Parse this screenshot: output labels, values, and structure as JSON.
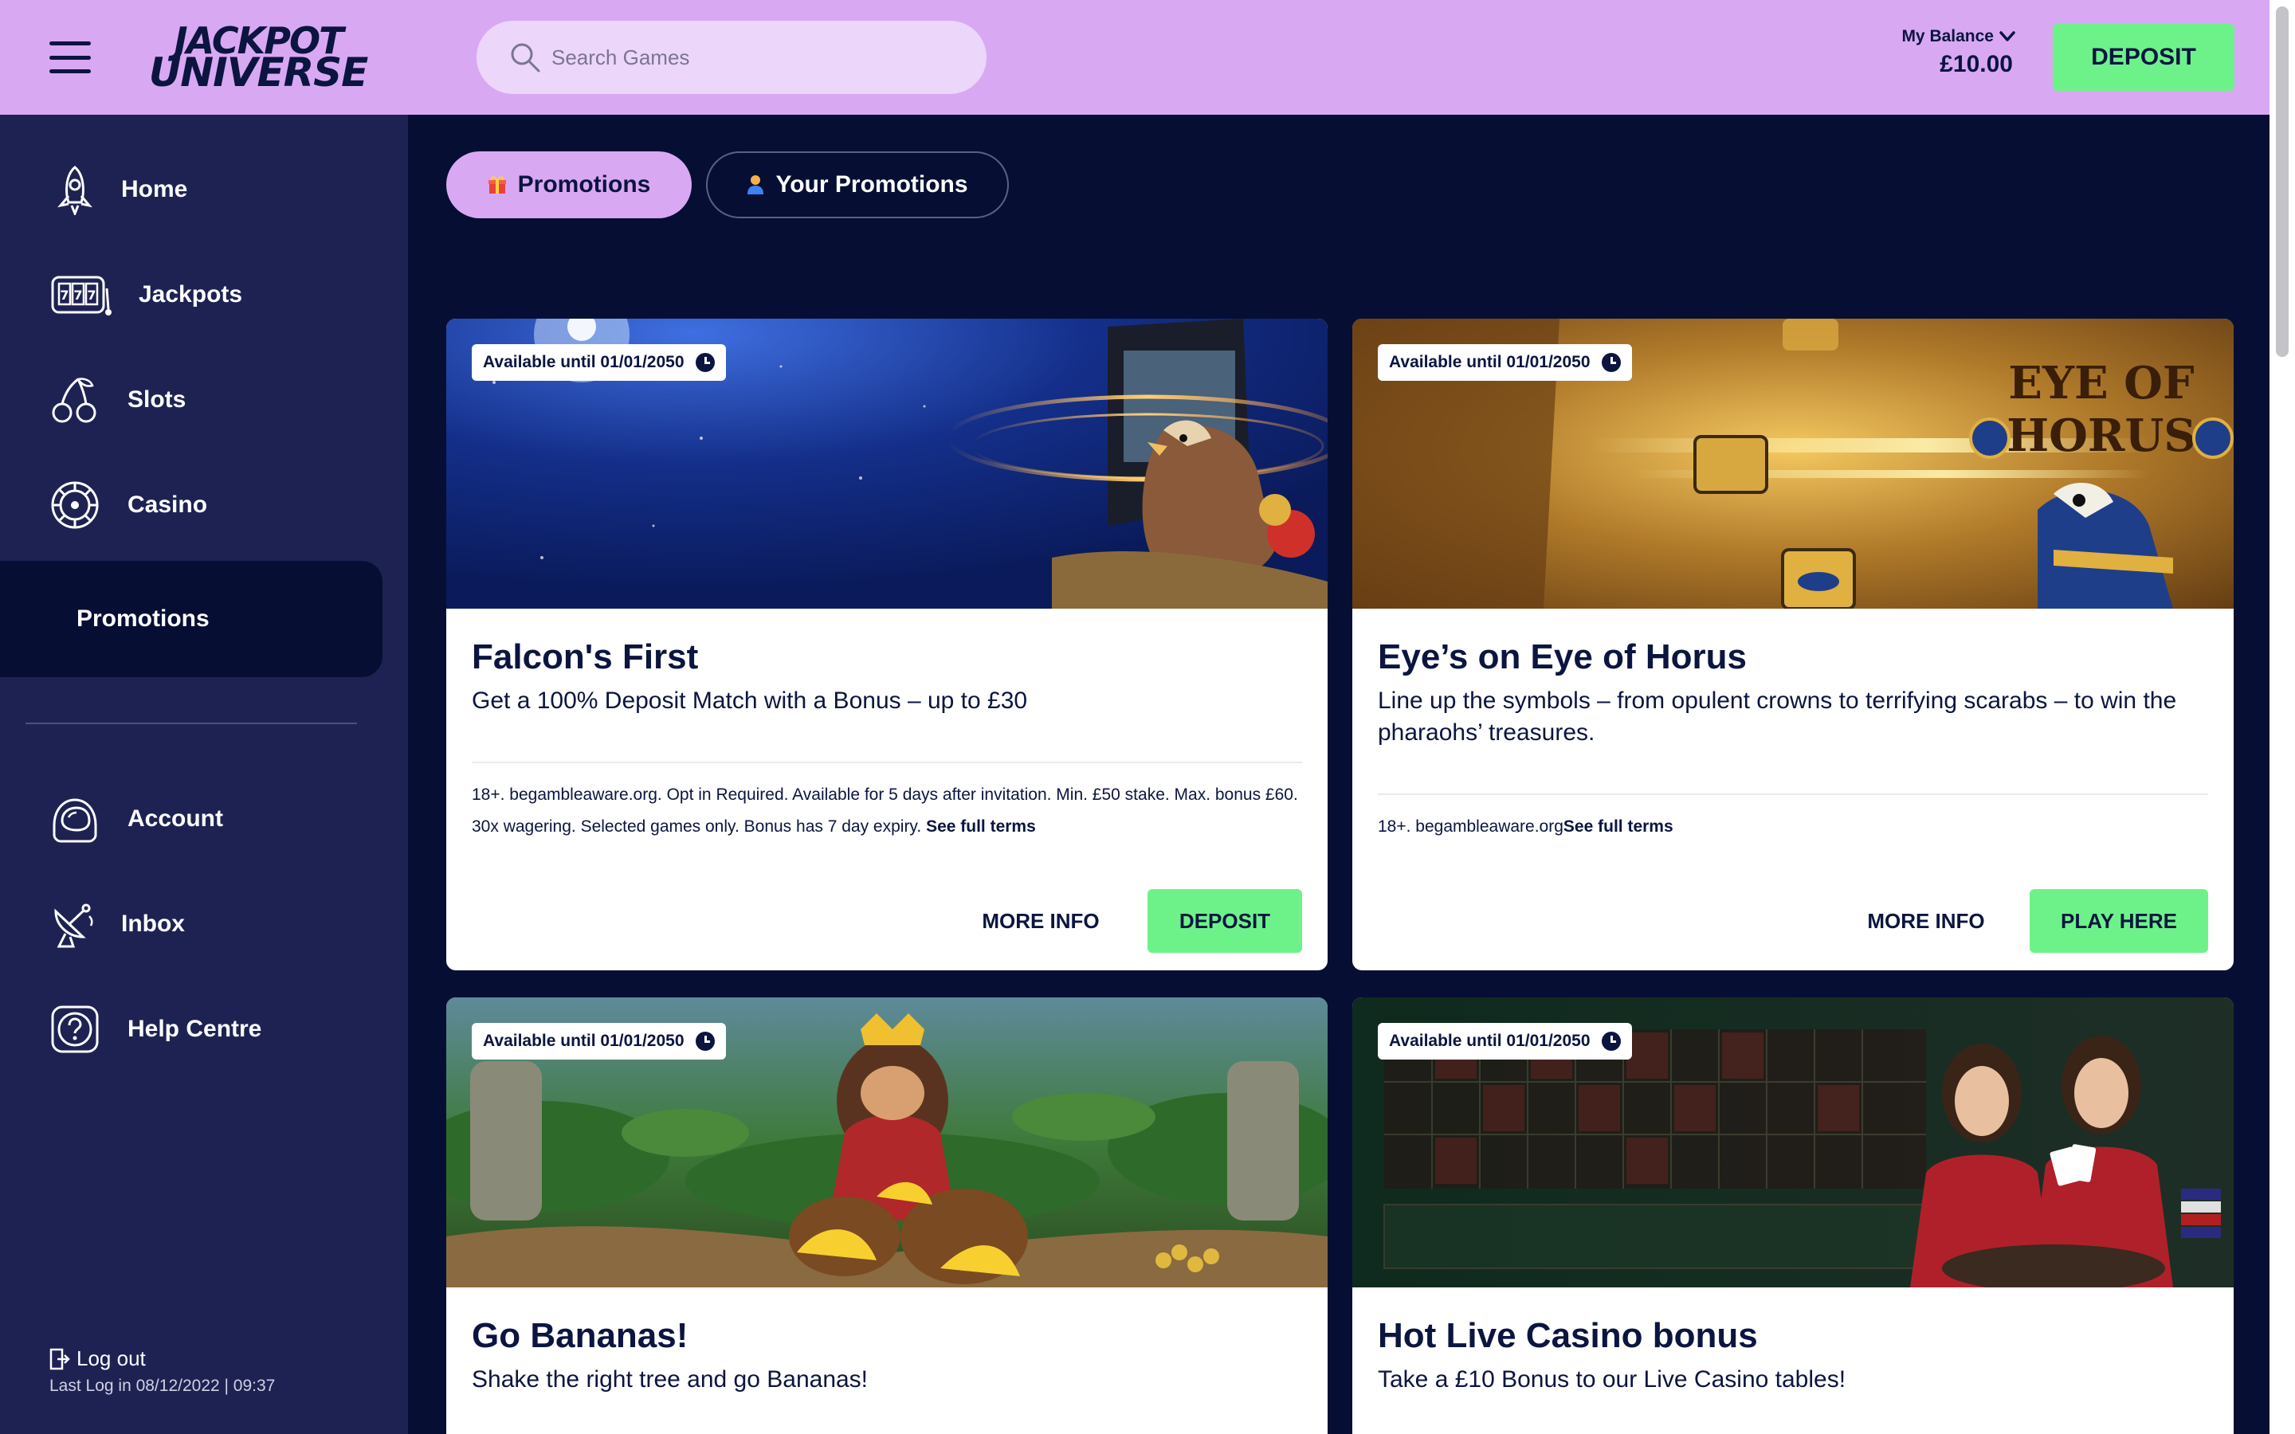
{
  "header": {
    "logo_line1": "JACKPOT",
    "logo_line2": "UNIVERSE",
    "search_placeholder": "Search Games",
    "balance_label": "My Balance",
    "balance_amount": "£10.00",
    "deposit_label": "DEPOSIT"
  },
  "sidebar": {
    "items": [
      {
        "label": "Home",
        "icon": "rocket-icon"
      },
      {
        "label": "Jackpots",
        "icon": "slot-machine-icon"
      },
      {
        "label": "Slots",
        "icon": "cherries-icon"
      },
      {
        "label": "Casino",
        "icon": "roulette-icon"
      },
      {
        "label": "Promotions",
        "icon": ""
      },
      {
        "label": "Account",
        "icon": "astronaut-helmet-icon"
      },
      {
        "label": "Inbox",
        "icon": "satellite-dish-icon"
      },
      {
        "label": "Help Centre",
        "icon": "question-icon"
      }
    ],
    "logout": "Log out",
    "last_log": "Last Log in 08/12/2022 | 09:37"
  },
  "tabs": [
    {
      "label": "Promotions",
      "icon": "gift-icon",
      "active": true
    },
    {
      "label": "Your Promotions",
      "icon": "user-icon",
      "active": false
    }
  ],
  "cards": [
    {
      "available": "Available until 01/01/2050",
      "title": "Falcon's First",
      "subtitle": "Get a 100% Deposit Match with a Bonus – up to £30",
      "terms": "18+. begambleaware.org. Opt in Required. Available for 5 days after invitation. Min. £50 stake. Max. bonus £60. 30x wagering. Selected games only. Bonus has 7 day expiry.",
      "terms_link": "See full terms",
      "more_label": "MORE INFO",
      "action_label": "DEPOSIT"
    },
    {
      "available": "Available until 01/01/2050",
      "title": "Eye’s on Eye of Horus",
      "subtitle": "Line up the symbols – from opulent crowns to terrifying scarabs – to win the pharaohs’ treasures.",
      "terms": "18+. begambleaware.org",
      "terms_link": "See full terms",
      "more_label": "MORE INFO",
      "action_label": "PLAY HERE",
      "banner_text_1": "EYE OF",
      "banner_text_2": "HORUS"
    },
    {
      "available": "Available until 01/01/2050",
      "title": "Go Bananas!",
      "subtitle": "Shake the right tree and go Bananas!"
    },
    {
      "available": "Available until 01/01/2050",
      "title": "Hot Live Casino bonus",
      "subtitle": "Take a £10 Bonus to our Live Casino tables!"
    }
  ],
  "colors": {
    "header_bg": "#d9a8f3",
    "sidebar_bg": "#1e2253",
    "page_bg": "#060f33",
    "accent_green": "#6df28a",
    "text_dark": "#0b1540"
  }
}
